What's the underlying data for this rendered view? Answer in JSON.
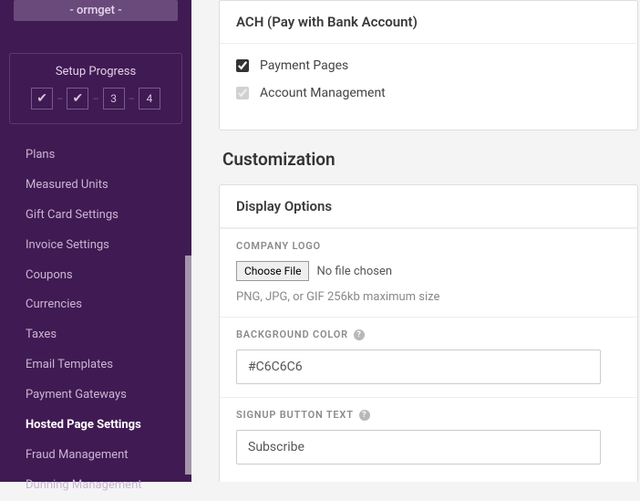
{
  "sidebar": {
    "brand": "- ormget -",
    "setup_title": "Setup Progress",
    "steps": [
      "✔",
      "✔",
      "3",
      "4"
    ],
    "items": [
      {
        "label": "Plans"
      },
      {
        "label": "Measured Units"
      },
      {
        "label": "Gift Card Settings"
      },
      {
        "label": "Invoice Settings"
      },
      {
        "label": "Coupons"
      },
      {
        "label": "Currencies"
      },
      {
        "label": "Taxes"
      },
      {
        "label": "Email Templates"
      },
      {
        "label": "Payment Gateways"
      },
      {
        "label": "Hosted Page Settings"
      },
      {
        "label": "Fraud Management"
      },
      {
        "label": "Dunning Management"
      }
    ]
  },
  "ach": {
    "header": "ACH (Pay with Bank Account)",
    "opt1": "Payment Pages",
    "opt2": "Account Management"
  },
  "customization": {
    "title": "Customization",
    "display_options": "Display Options",
    "logo": {
      "label": "COMPANY LOGO",
      "choose": "Choose File",
      "status": "No file chosen",
      "hint": "PNG, JPG, or GIF 256kb maximum size"
    },
    "bgcolor": {
      "label": "BACKGROUND COLOR",
      "value": "#C6C6C6"
    },
    "signup": {
      "label": "SIGNUP BUTTON TEXT",
      "value": "Subscribe"
    }
  }
}
